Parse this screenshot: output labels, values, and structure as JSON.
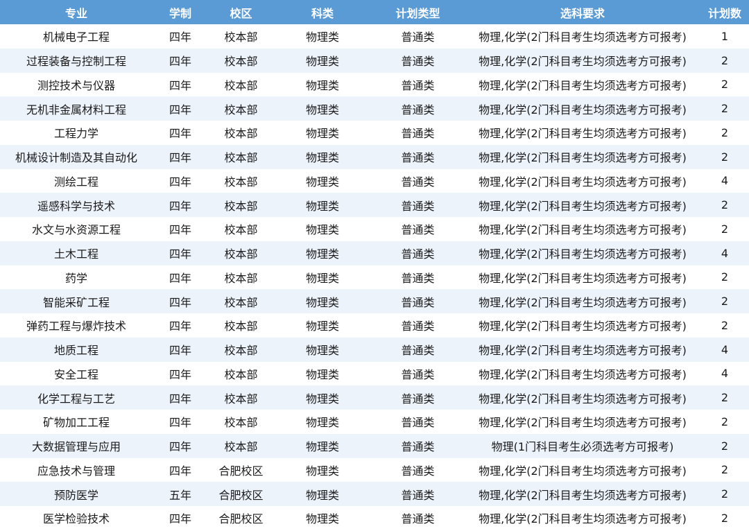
{
  "table": {
    "headers": [
      "专业",
      "学制",
      "校区",
      "科类",
      "计划类型",
      "选科要求",
      "计划数"
    ],
    "rows": [
      [
        "机械电子工程",
        "四年",
        "校本部",
        "物理类",
        "普通类",
        "物理,化学(2门科目考生均须选考方可报考)",
        "1"
      ],
      [
        "过程装备与控制工程",
        "四年",
        "校本部",
        "物理类",
        "普通类",
        "物理,化学(2门科目考生均须选考方可报考)",
        "2"
      ],
      [
        "测控技术与仪器",
        "四年",
        "校本部",
        "物理类",
        "普通类",
        "物理,化学(2门科目考生均须选考方可报考)",
        "2"
      ],
      [
        "无机非金属材料工程",
        "四年",
        "校本部",
        "物理类",
        "普通类",
        "物理,化学(2门科目考生均须选考方可报考)",
        "2"
      ],
      [
        "工程力学",
        "四年",
        "校本部",
        "物理类",
        "普通类",
        "物理,化学(2门科目考生均须选考方可报考)",
        "2"
      ],
      [
        "机械设计制造及其自动化",
        "四年",
        "校本部",
        "物理类",
        "普通类",
        "物理,化学(2门科目考生均须选考方可报考)",
        "2"
      ],
      [
        "测绘工程",
        "四年",
        "校本部",
        "物理类",
        "普通类",
        "物理,化学(2门科目考生均须选考方可报考)",
        "4"
      ],
      [
        "遥感科学与技术",
        "四年",
        "校本部",
        "物理类",
        "普通类",
        "物理,化学(2门科目考生均须选考方可报考)",
        "2"
      ],
      [
        "水文与水资源工程",
        "四年",
        "校本部",
        "物理类",
        "普通类",
        "物理,化学(2门科目考生均须选考方可报考)",
        "2"
      ],
      [
        "土木工程",
        "四年",
        "校本部",
        "物理类",
        "普通类",
        "物理,化学(2门科目考生均须选考方可报考)",
        "4"
      ],
      [
        "药学",
        "四年",
        "校本部",
        "物理类",
        "普通类",
        "物理,化学(2门科目考生均须选考方可报考)",
        "2"
      ],
      [
        "智能采矿工程",
        "四年",
        "校本部",
        "物理类",
        "普通类",
        "物理,化学(2门科目考生均须选考方可报考)",
        "2"
      ],
      [
        "弹药工程与爆炸技术",
        "四年",
        "校本部",
        "物理类",
        "普通类",
        "物理,化学(2门科目考生均须选考方可报考)",
        "2"
      ],
      [
        "地质工程",
        "四年",
        "校本部",
        "物理类",
        "普通类",
        "物理,化学(2门科目考生均须选考方可报考)",
        "4"
      ],
      [
        "安全工程",
        "四年",
        "校本部",
        "物理类",
        "普通类",
        "物理,化学(2门科目考生均须选考方可报考)",
        "4"
      ],
      [
        "化学工程与工艺",
        "四年",
        "校本部",
        "物理类",
        "普通类",
        "物理,化学(2门科目考生均须选考方可报考)",
        "2"
      ],
      [
        "矿物加工工程",
        "四年",
        "校本部",
        "物理类",
        "普通类",
        "物理,化学(2门科目考生均须选考方可报考)",
        "2"
      ],
      [
        "大数据管理与应用",
        "四年",
        "校本部",
        "物理类",
        "普通类",
        "物理(1门科目考生必须选考方可报考)",
        "2"
      ],
      [
        "应急技术与管理",
        "四年",
        "合肥校区",
        "物理类",
        "普通类",
        "物理,化学(2门科目考生均须选考方可报考)",
        "2"
      ],
      [
        "预防医学",
        "五年",
        "合肥校区",
        "物理类",
        "普通类",
        "物理,化学(2门科目考生均须选考方可报考)",
        "2"
      ],
      [
        "医学检验技术",
        "四年",
        "合肥校区",
        "物理类",
        "普通类",
        "物理,化学(2门科目考生均须选考方可报考)",
        "2"
      ]
    ]
  },
  "colors": {
    "header_bg": "#5b9bd5",
    "header_text": "#ffffff",
    "stripe": "#edf3fb"
  }
}
